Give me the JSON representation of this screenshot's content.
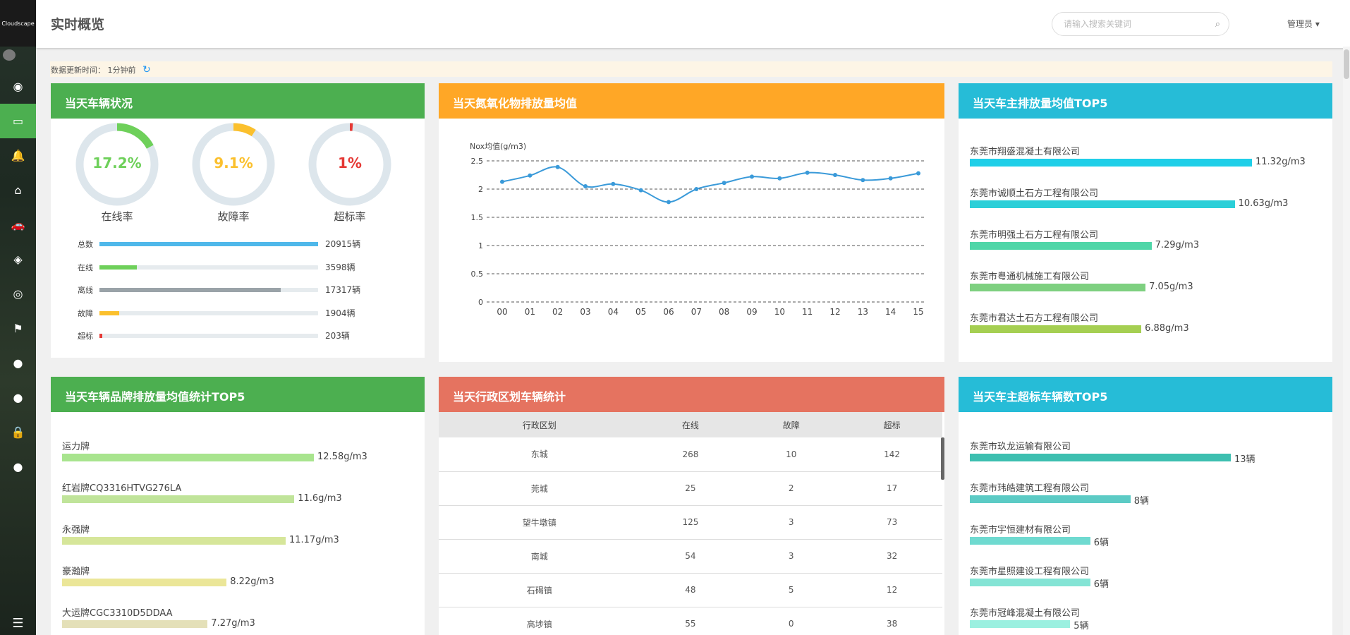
{
  "sidebar": {
    "logo_text": "Cloudscape",
    "items": [
      {
        "name": "dashboard-icon",
        "glyph": "◉"
      },
      {
        "name": "monitor-icon",
        "glyph": "▭",
        "active": true
      },
      {
        "name": "bell-icon",
        "glyph": "🔔"
      },
      {
        "name": "home-icon",
        "glyph": "⌂"
      },
      {
        "name": "car-icon",
        "glyph": "🚗"
      },
      {
        "name": "cube-icon",
        "glyph": "◈"
      },
      {
        "name": "chrome-icon",
        "glyph": "◎"
      },
      {
        "name": "flag-icon",
        "glyph": "⚑"
      },
      {
        "name": "user-icon",
        "glyph": "●"
      },
      {
        "name": "user-circle-icon",
        "glyph": "●"
      },
      {
        "name": "lock-icon",
        "glyph": "🔒"
      },
      {
        "name": "account-icon",
        "glyph": "●"
      }
    ],
    "menu_glyph": "☰"
  },
  "header": {
    "title": "实时概览",
    "search_placeholder": "请输入搜索关键词",
    "user_label": "管理员 ▾"
  },
  "update": {
    "label": "数据更新时间：",
    "value": "1分钟前",
    "refresh_glyph": "↻"
  },
  "vehicle_status": {
    "title": "当天车辆状况",
    "gauges": [
      {
        "label": "在线率",
        "value_text": "17.2%",
        "value": 0.172,
        "color": "#6ed05a"
      },
      {
        "label": "故障率",
        "value_text": "9.1%",
        "value": 0.091,
        "color": "#fbc02d"
      },
      {
        "label": "超标率",
        "value_text": "1%",
        "value": 0.01,
        "color": "#e53935"
      }
    ],
    "bars": [
      {
        "label": "总数",
        "value_text": "20915辆",
        "value": 1.0,
        "color": "#4fb8ea"
      },
      {
        "label": "在线",
        "value_text": "3598辆",
        "value": 0.172,
        "color": "#6ed05a"
      },
      {
        "label": "离线",
        "value_text": "17317辆",
        "value": 0.828,
        "color": "#9aa3a8"
      },
      {
        "label": "故障",
        "value_text": "1904辆",
        "value": 0.091,
        "color": "#fbc02d"
      },
      {
        "label": "超标",
        "value_text": "203辆",
        "value": 0.01,
        "color": "#e53935"
      }
    ]
  },
  "nox": {
    "title": "当天氮氧化物排放量均值",
    "chart_data": {
      "type": "line",
      "ylabel": "Nox均值(g/m3)",
      "ylim": [
        0,
        2.5
      ],
      "yticks": [
        "0",
        "0.5",
        "1",
        "1.5",
        "2",
        "2.5"
      ],
      "categories": [
        "00",
        "01",
        "02",
        "03",
        "04",
        "05",
        "06",
        "07",
        "08",
        "09",
        "10",
        "11",
        "12",
        "13",
        "14",
        "15"
      ],
      "values": [
        2.13,
        2.24,
        2.39,
        2.05,
        2.09,
        1.98,
        1.77,
        2.0,
        2.11,
        2.22,
        2.19,
        2.29,
        2.25,
        2.16,
        2.19,
        2.28
      ],
      "color": "#3a9ad9",
      "grid": true
    }
  },
  "owner_emission": {
    "title": "当天车主排放量均值TOP5",
    "items": [
      {
        "name": "东莞市翔盛混凝土有限公司",
        "value_text": "11.32g/m3",
        "value": 11.32,
        "color": "#1fcfe8"
      },
      {
        "name": "东莞市诚顺土石方工程有限公司",
        "value_text": "10.63g/m3",
        "value": 10.63,
        "color": "#2bcfd8"
      },
      {
        "name": "东莞市明强土石方工程有限公司",
        "value_text": "7.29g/m3",
        "value": 7.29,
        "color": "#4fd6a8"
      },
      {
        "name": "东莞市粤通机械施工有限公司",
        "value_text": "7.05g/m3",
        "value": 7.05,
        "color": "#7ed080"
      },
      {
        "name": "东莞市君达土石方工程有限公司",
        "value_text": "6.88g/m3",
        "value": 6.88,
        "color": "#a5cf52"
      }
    ]
  },
  "brand_emission": {
    "title": "当天车辆品牌排放量均值统计TOP5",
    "items": [
      {
        "name": "运力牌",
        "value_text": "12.58g/m3",
        "value": 12.58,
        "color": "#a8e48e"
      },
      {
        "name": "红岩牌CQ3316HTVG276LA",
        "value_text": "11.6g/m3",
        "value": 11.6,
        "color": "#c0e49a"
      },
      {
        "name": "永强牌",
        "value_text": "11.17g/m3",
        "value": 11.17,
        "color": "#d6e69a"
      },
      {
        "name": "豪瀚牌",
        "value_text": "8.22g/m3",
        "value": 8.22,
        "color": "#ebe698"
      },
      {
        "name": "大运牌CGC3310D5DDAA",
        "value_text": "7.27g/m3",
        "value": 7.27,
        "color": "#e4e0b8"
      }
    ]
  },
  "region": {
    "title": "当天行政区划车辆统计",
    "columns": [
      "行政区划",
      "在线",
      "故障",
      "超标"
    ],
    "rows": [
      [
        "东城",
        "268",
        "10",
        "142"
      ],
      [
        "莞城",
        "25",
        "2",
        "17"
      ],
      [
        "望牛墩镇",
        "125",
        "3",
        "73"
      ],
      [
        "南城",
        "54",
        "3",
        "32"
      ],
      [
        "石碣镇",
        "48",
        "5",
        "12"
      ],
      [
        "高埗镇",
        "55",
        "0",
        "38"
      ]
    ]
  },
  "owner_overlimit": {
    "title": "当天车主超标车辆数TOP5",
    "items": [
      {
        "name": "东莞市玖龙运输有限公司",
        "value_text": "13辆",
        "value": 13,
        "color": "#3dbfb0"
      },
      {
        "name": "东莞市玮皓建筑工程有限公司",
        "value_text": "8辆",
        "value": 8,
        "color": "#5ccbc5"
      },
      {
        "name": "东莞市宇恒建材有限公司",
        "value_text": "6辆",
        "value": 6,
        "color": "#6fdad0"
      },
      {
        "name": "东莞市星照建设工程有限公司",
        "value_text": "6辆",
        "value": 6,
        "color": "#84e4d5"
      },
      {
        "name": "东莞市冠峰混凝土有限公司",
        "value_text": "5辆",
        "value": 5,
        "color": "#9bf0e0"
      }
    ]
  }
}
